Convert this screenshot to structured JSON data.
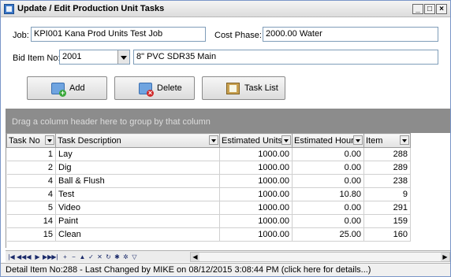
{
  "window": {
    "title": "Update / Edit Production Unit Tasks"
  },
  "form": {
    "job_label": "Job:",
    "job_value": "KPI001 Kana Prod Units Test Job",
    "cost_phase_label": "Cost Phase:",
    "cost_phase_value": "2000.00 Water",
    "bid_item_label": "Bid Item No:",
    "bid_item_value": "2001",
    "bid_item_desc": "8\" PVC SDR35 Main"
  },
  "toolbar": {
    "add_label": "Add",
    "delete_label": "Delete",
    "tasklist_label": "Task List"
  },
  "grid": {
    "group_hint": "Drag a column header here to group by that column",
    "columns": [
      "Task No",
      "Task Description",
      "Estimated Units",
      "Estimated Hours",
      "Item"
    ],
    "rows": [
      {
        "task_no": "1",
        "desc": "Lay",
        "units": "1000.00",
        "hours": "0.00",
        "item": "288"
      },
      {
        "task_no": "2",
        "desc": "Dig",
        "units": "1000.00",
        "hours": "0.00",
        "item": "289"
      },
      {
        "task_no": "4",
        "desc": "Ball & Flush",
        "units": "1000.00",
        "hours": "0.00",
        "item": "238"
      },
      {
        "task_no": "4",
        "desc": "Test",
        "units": "1000.00",
        "hours": "10.80",
        "item": "9"
      },
      {
        "task_no": "5",
        "desc": "Video",
        "units": "1000.00",
        "hours": "0.00",
        "item": "291"
      },
      {
        "task_no": "14",
        "desc": "Paint",
        "units": "1000.00",
        "hours": "0.00",
        "item": "159"
      },
      {
        "task_no": "15",
        "desc": "Clean",
        "units": "1000.00",
        "hours": "25.00",
        "item": "160"
      }
    ]
  },
  "status": {
    "text": "Detail Item No:288 - Last Changed by MIKE on 08/12/2015 3:08:44 PM (click here for details...)"
  },
  "icons": {
    "app": "app-icon",
    "add": "add-icon",
    "delete": "delete-icon",
    "tasklist": "task-list-icon",
    "nav": [
      "first-icon",
      "prev-page-icon",
      "prev-icon",
      "next-icon",
      "next-page-icon",
      "last-icon",
      "insert-icon",
      "delete-record-icon",
      "edit-icon",
      "post-icon",
      "cancel-icon",
      "refresh-icon",
      "bookmark-icon",
      "goto-bookmark-icon",
      "filter-icon"
    ]
  }
}
